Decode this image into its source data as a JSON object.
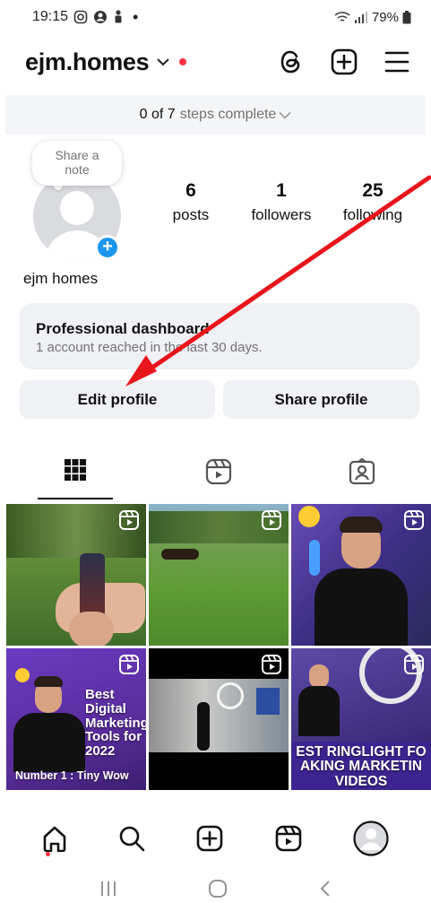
{
  "status_bar": {
    "time": "19:15",
    "battery": "79%"
  },
  "header": {
    "username": "ejm.homes",
    "icons": [
      "threads-icon",
      "create-plus-icon",
      "menu-hamburger-icon"
    ]
  },
  "steps": {
    "count": "0 of 7",
    "label": "steps complete"
  },
  "note": {
    "text": "Share a note"
  },
  "stats": {
    "posts": {
      "value": "6",
      "label": "posts"
    },
    "followers": {
      "value": "1",
      "label": "followers"
    },
    "following": {
      "value": "25",
      "label": "following"
    }
  },
  "profile": {
    "display_name": "ejm homes"
  },
  "dashboard": {
    "title": "Professional dashboard",
    "subtitle": "1 account reached in the last 30 days."
  },
  "buttons": {
    "edit_profile": "Edit profile",
    "share_profile": "Share profile"
  },
  "tabs": [
    "grid-icon",
    "reels-icon",
    "tagged-icon"
  ],
  "grid": {
    "tile4": {
      "line1": "Best",
      "line2": "Digital",
      "line3": "Marketing",
      "line4": "Tools for",
      "line5": "2022",
      "footer": "Number 1 : Tiny Wow"
    },
    "tile5": {},
    "tile6": {
      "line1": "EST RINGLIGHT FO",
      "line2": "AKING MARKETIN",
      "line3": "VIDEOS"
    }
  },
  "bottom_nav": [
    "home-icon",
    "search-icon",
    "create-icon",
    "reels-icon",
    "profile-icon"
  ],
  "colors": {
    "accent_blue": "#1d96f0",
    "notification_red": "#ff3040",
    "annotation_arrow": "#e8151b",
    "reel_purple": "#5a2d9c"
  }
}
